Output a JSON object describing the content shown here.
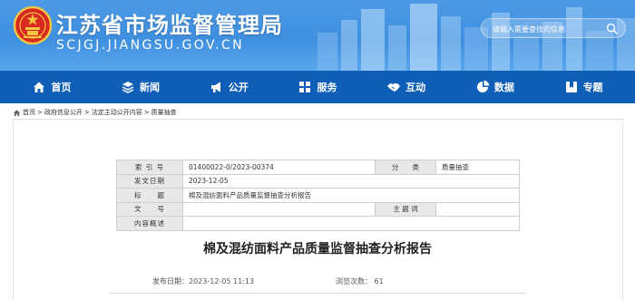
{
  "header": {
    "site_title": "江苏省市场监督管理局",
    "site_domain": "SCJGJ.JIANGSU.GOV.CN",
    "search_placeholder": "请输入需要查找的信息"
  },
  "nav": [
    {
      "label": "首页",
      "icon": "home-icon"
    },
    {
      "label": "新闻",
      "icon": "layers-icon"
    },
    {
      "label": "公开",
      "icon": "megaphone-icon"
    },
    {
      "label": "服务",
      "icon": "grid-icon"
    },
    {
      "label": "互动",
      "icon": "handshake-icon"
    },
    {
      "label": "数据",
      "icon": "pie-chart-icon"
    },
    {
      "label": "专题",
      "icon": "bookmark-icon"
    }
  ],
  "breadcrumb": {
    "items": [
      "首页",
      "政府信息公开",
      "法定主动公开内容",
      "质量抽查"
    ],
    "separator": ">"
  },
  "meta": {
    "index_label": "索 引 号",
    "index_value": "01400022-0/2023-00374",
    "category_label": "分　　类",
    "category_value": "质量抽查",
    "date_label": "发文日期",
    "date_value": "2023-12-05",
    "title_label": "标　　题",
    "title_value": "棉及混纺面料产品质量监督抽查分析报告",
    "docno_label": "文　　号",
    "docno_value": "",
    "subject_label": "主 题 词",
    "subject_value": "",
    "summary_label": "内容概述",
    "summary_value": ""
  },
  "article": {
    "title": "棉及混纺面料产品质量监督抽查分析报告",
    "published": "发布日期：2023-12-05 11:13",
    "views": "浏览次数： 61"
  },
  "colors": {
    "banner": "#4d9be6",
    "nav": "#0f5eb8",
    "table_label_bg": "#e8e8e8"
  }
}
